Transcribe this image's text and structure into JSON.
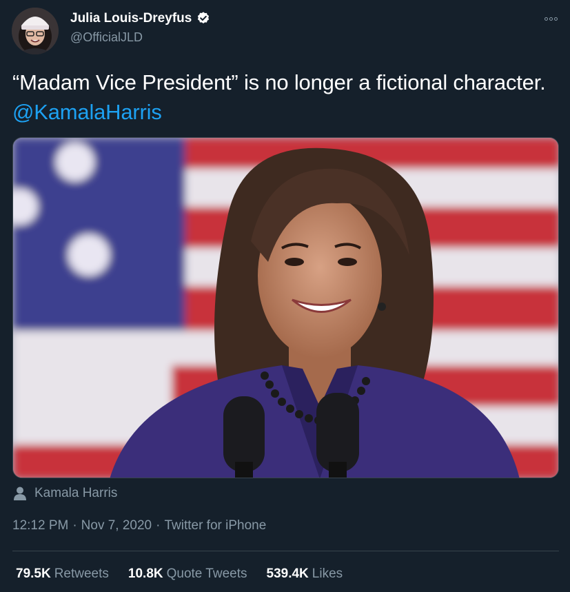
{
  "author": {
    "display_name": "Julia Louis-Dreyfus",
    "handle": "@OfficialJLD",
    "verified": true
  },
  "tweet": {
    "text_before": "“Madam Vice President” is no longer a fictional character. ",
    "mention": "@KamalaHarris"
  },
  "media": {
    "tagged_person": "Kamala Harris"
  },
  "meta": {
    "time": "12:12 PM",
    "sep1": "·",
    "date": "Nov 7, 2020",
    "sep2": "·",
    "source": "Twitter for iPhone"
  },
  "stats": {
    "retweets_count": "79.5K",
    "retweets_label": "Retweets",
    "quotes_count": "10.8K",
    "quotes_label": "Quote Tweets",
    "likes_count": "539.4K",
    "likes_label": "Likes"
  },
  "colors": {
    "background": "#15202b",
    "accent": "#1da1f2",
    "secondary_text": "#8899a6",
    "divider": "#38444d"
  },
  "icons": [
    "verified-badge-icon",
    "more-options-icon",
    "person-icon"
  ]
}
